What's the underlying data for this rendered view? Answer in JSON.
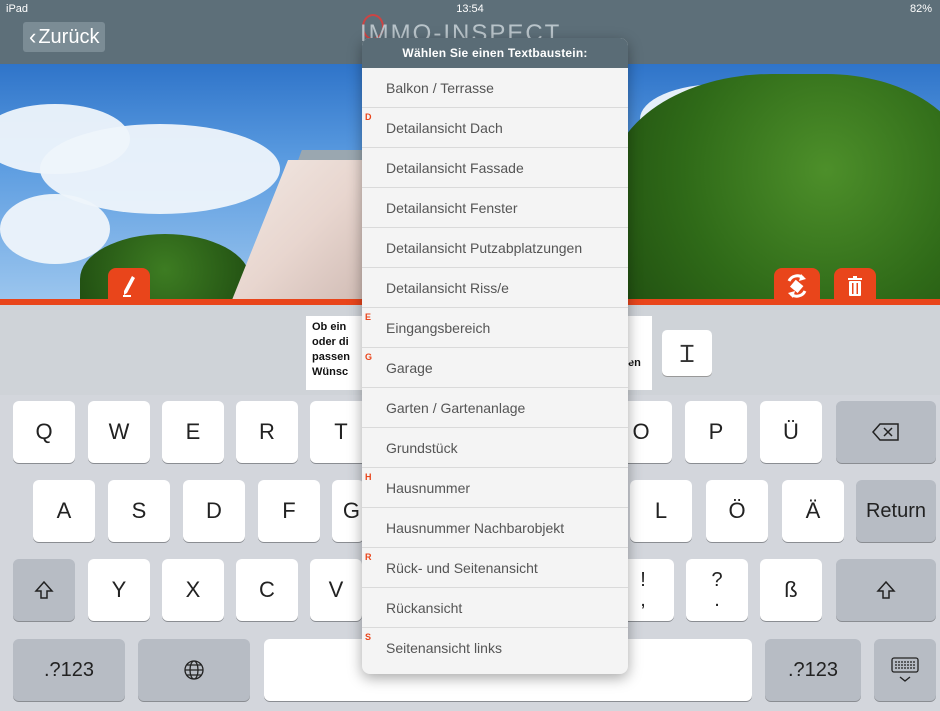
{
  "status": {
    "device": "iPad",
    "time": "13:54",
    "battery": "82%"
  },
  "nav": {
    "back_label": "Zurück",
    "logo": "IMMO-INSPECT"
  },
  "editor": {
    "lines": [
      "Ob ein",
      "oder di",
      "passen",
      "Wünsc"
    ],
    "tail": "en",
    "cursor_icon": "text-cursor-icon"
  },
  "dropdown": {
    "header": "Wählen Sie einen Textbaustein:",
    "items": [
      {
        "section": "",
        "label": "Balkon / Terrasse"
      },
      {
        "section": "D",
        "label": "Detailansicht Dach"
      },
      {
        "section": "",
        "label": "Detailansicht Fassade"
      },
      {
        "section": "",
        "label": "Detailansicht Fenster"
      },
      {
        "section": "",
        "label": "Detailansicht Putzabplatzungen"
      },
      {
        "section": "",
        "label": "Detailansicht Riss/e"
      },
      {
        "section": "E",
        "label": "Eingangsbereich"
      },
      {
        "section": "G",
        "label": "Garage"
      },
      {
        "section": "",
        "label": "Garten / Gartenanlage"
      },
      {
        "section": "",
        "label": "Grundstück"
      },
      {
        "section": "H",
        "label": "Hausnummer"
      },
      {
        "section": "",
        "label": "Hausnummer Nachbarobjekt"
      },
      {
        "section": "R",
        "label": "Rück- und Seitenansicht"
      },
      {
        "section": "",
        "label": "Rückansicht"
      },
      {
        "section": "S",
        "label": "Seitenansicht links"
      }
    ]
  },
  "keyboard": {
    "row1": [
      "Q",
      "W",
      "E",
      "R",
      "T",
      "O",
      "P",
      "Ü"
    ],
    "row2": [
      "A",
      "S",
      "D",
      "F",
      "G",
      "L",
      "Ö",
      "Ä"
    ],
    "row3": [
      "Y",
      "X",
      "C",
      "V",
      "ß"
    ],
    "punct1": [
      "!",
      ","
    ],
    "punct2": [
      "?",
      "."
    ],
    "return_label": "Return",
    "numbers_label": ".?123",
    "numbers_label_right": ".?123"
  },
  "colors": {
    "accent": "#e9451b",
    "nav": "#5d6f79"
  }
}
